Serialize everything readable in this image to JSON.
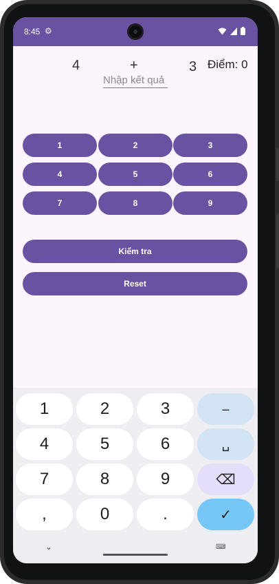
{
  "status": {
    "time": "8:45"
  },
  "quiz": {
    "num1": "4",
    "operator": "+",
    "num2": "3",
    "score": "Điểm: 0",
    "answer_placeholder": "Nhập kết quả",
    "answer_value": ""
  },
  "digits": [
    "1",
    "2",
    "3",
    "4",
    "5",
    "6",
    "7",
    "8",
    "9"
  ],
  "actions": {
    "check_label": "Kiểm tra",
    "reset_label": "Reset"
  },
  "keyboard": {
    "keys": [
      "1",
      "2",
      "3",
      "–",
      "4",
      "5",
      "6",
      "␣",
      "7",
      "8",
      "9",
      "⌫",
      ",",
      "0",
      ".",
      "✓"
    ]
  },
  "colors": {
    "primary": "#6a52a3",
    "background": "#fdf5fd",
    "keyboard": "#eeeef2",
    "enter_key": "#76c7f5"
  }
}
